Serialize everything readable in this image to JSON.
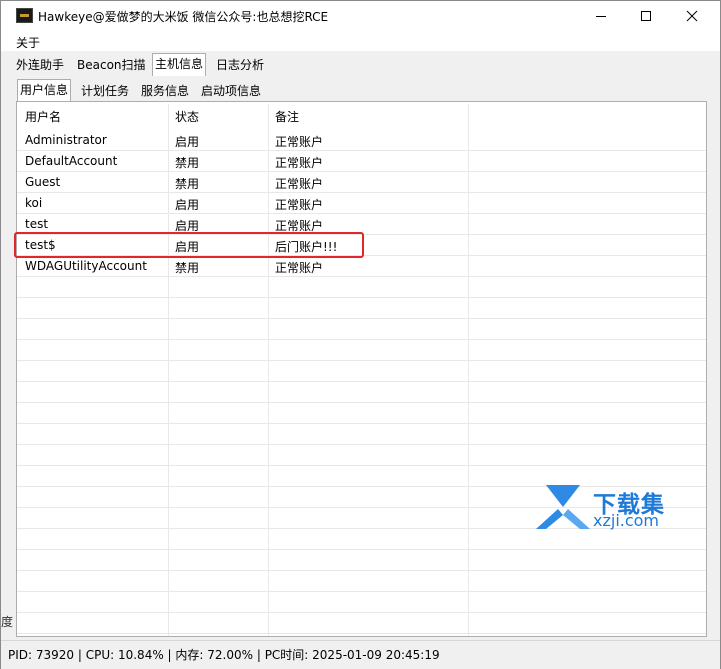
{
  "window": {
    "title": "Hawkeye@爱做梦的大米饭 微信公众号:也总想挖RCE"
  },
  "menu": {
    "items": [
      "关于"
    ]
  },
  "main_tabs": {
    "items": [
      "外连助手",
      "Beacon扫描",
      "主机信息",
      "日志分析"
    ],
    "selected": "主机信息"
  },
  "sub_tabs": {
    "items": [
      "用户信息",
      "计划任务",
      "服务信息",
      "启动项信息"
    ],
    "selected": "用户信息"
  },
  "table": {
    "columns": [
      "用户名",
      "状态",
      "备注"
    ],
    "rows": [
      {
        "user": "Administrator",
        "status": "启用",
        "note": "正常账户"
      },
      {
        "user": "DefaultAccount",
        "status": "禁用",
        "note": "正常账户"
      },
      {
        "user": "Guest",
        "status": "禁用",
        "note": "正常账户"
      },
      {
        "user": "koi",
        "status": "启用",
        "note": "正常账户"
      },
      {
        "user": "test",
        "status": "启用",
        "note": "正常账户"
      },
      {
        "user": "test$",
        "status": "启用",
        "note": "后门账户!!!"
      },
      {
        "user": "WDAGUtilityAccount",
        "status": "禁用",
        "note": "正常账户"
      }
    ]
  },
  "statusbar": {
    "text": "PID: 73920 | CPU: 10.84% | 内存: 72.00% | PC时间: 2025-01-09 20:45:19"
  },
  "watermark": {
    "brand": "下载集",
    "url": "xzji.com"
  },
  "edge_glyph": "度",
  "colors": {
    "highlight": "#e0282a",
    "watermark": "#1e7ad8"
  }
}
